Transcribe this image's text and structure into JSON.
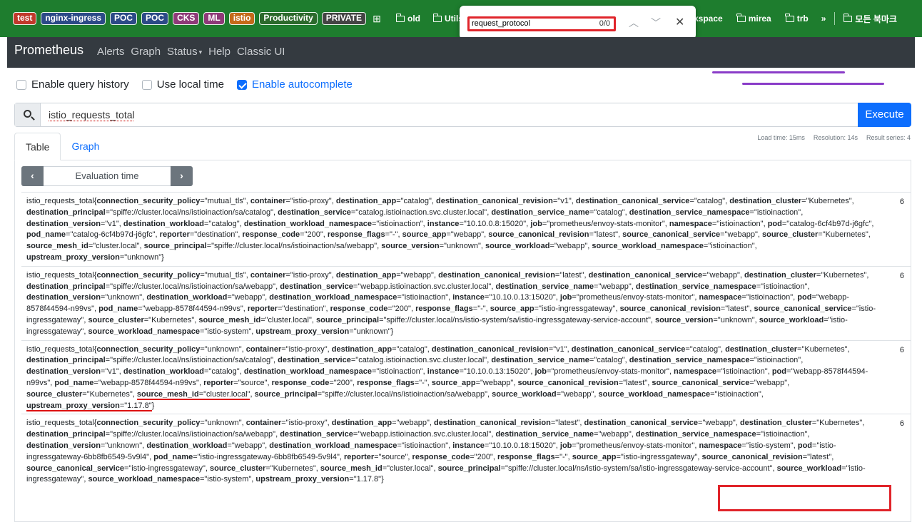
{
  "bookmarks": {
    "tags": [
      {
        "label": "test",
        "color": "red"
      },
      {
        "label": "nginx-ingress",
        "color": "blue"
      },
      {
        "label": "POC",
        "color": "blue"
      },
      {
        "label": "POC",
        "color": "blue"
      },
      {
        "label": "CKS",
        "color": "pink"
      },
      {
        "label": "ML",
        "color": "pink"
      },
      {
        "label": "istio",
        "color": "orange"
      },
      {
        "label": "Productivity",
        "color": "green"
      },
      {
        "label": "PRIVATE",
        "color": "dark"
      }
    ],
    "folders_left": [
      "old",
      "Utils"
    ],
    "folders_right": [
      "kspace",
      "mirea",
      "trb"
    ],
    "overflow": "»",
    "all_bookmarks": "모든 북마크"
  },
  "find": {
    "query": "request_protocol",
    "count": "0/0"
  },
  "nav": {
    "brand": "Prometheus",
    "items": [
      "Alerts",
      "Graph",
      "Status",
      "Help",
      "Classic UI"
    ]
  },
  "options": {
    "query_history": "Enable query history",
    "local_time": "Use local time",
    "autocomplete": "Enable autocomplete"
  },
  "query": {
    "expression": "istio_requests_total",
    "execute": "Execute"
  },
  "stats": {
    "load_time": "Load time: 15ms",
    "resolution": "Resolution: 14s",
    "result_series": "Result series: 4"
  },
  "tabs": {
    "table": "Table",
    "graph": "Graph"
  },
  "eval": {
    "label": "Evaluation time",
    "prev": "‹",
    "next": "›"
  },
  "results": [
    {
      "metric": "istio_requests_total",
      "value": "6",
      "labels": [
        [
          "connection_security_policy",
          "mutual_tls"
        ],
        [
          "container",
          "istio-proxy"
        ],
        [
          "destination_app",
          "catalog"
        ],
        [
          "destination_canonical_revision",
          "v1"
        ],
        [
          "destination_canonical_service",
          "catalog"
        ],
        [
          "destination_cluster",
          "Kubernetes"
        ],
        [
          "destination_principal",
          "spiffe://cluster.local/ns/istioinaction/sa/catalog"
        ],
        [
          "destination_service",
          "catalog.istioinaction.svc.cluster.local"
        ],
        [
          "destination_service_name",
          "catalog"
        ],
        [
          "destination_service_namespace",
          "istioinaction"
        ],
        [
          "destination_version",
          "v1"
        ],
        [
          "destination_workload",
          "catalog"
        ],
        [
          "destination_workload_namespace",
          "istioinaction"
        ],
        [
          "instance",
          "10.10.0.8:15020"
        ],
        [
          "job",
          "prometheus/envoy-stats-monitor"
        ],
        [
          "namespace",
          "istioinaction"
        ],
        [
          "pod",
          "catalog-6cf4b97d-j6gfc"
        ],
        [
          "pod_name",
          "catalog-6cf4b97d-j6gfc"
        ],
        [
          "reporter",
          "destination"
        ],
        [
          "response_code",
          "200"
        ],
        [
          "response_flags",
          "-"
        ],
        [
          "source_app",
          "webapp"
        ],
        [
          "source_canonical_revision",
          "latest"
        ],
        [
          "source_canonical_service",
          "webapp"
        ],
        [
          "source_cluster",
          "Kubernetes"
        ],
        [
          "source_mesh_id",
          "cluster.local"
        ],
        [
          "source_principal",
          "spiffe://cluster.local/ns/istioinaction/sa/webapp"
        ],
        [
          "source_version",
          "unknown"
        ],
        [
          "source_workload",
          "webapp"
        ],
        [
          "source_workload_namespace",
          "istioinaction"
        ],
        [
          "upstream_proxy_version",
          "unknown"
        ]
      ]
    },
    {
      "metric": "istio_requests_total",
      "value": "6",
      "labels": [
        [
          "connection_security_policy",
          "mutual_tls"
        ],
        [
          "container",
          "istio-proxy"
        ],
        [
          "destination_app",
          "webapp"
        ],
        [
          "destination_canonical_revision",
          "latest"
        ],
        [
          "destination_canonical_service",
          "webapp"
        ],
        [
          "destination_cluster",
          "Kubernetes"
        ],
        [
          "destination_principal",
          "spiffe://cluster.local/ns/istioinaction/sa/webapp"
        ],
        [
          "destination_service",
          "webapp.istioinaction.svc.cluster.local"
        ],
        [
          "destination_service_name",
          "webapp"
        ],
        [
          "destination_service_namespace",
          "istioinaction"
        ],
        [
          "destination_version",
          "unknown"
        ],
        [
          "destination_workload",
          "webapp"
        ],
        [
          "destination_workload_namespace",
          "istioinaction"
        ],
        [
          "instance",
          "10.10.0.13:15020"
        ],
        [
          "job",
          "prometheus/envoy-stats-monitor"
        ],
        [
          "namespace",
          "istioinaction"
        ],
        [
          "pod",
          "webapp-8578f44594-n99vs"
        ],
        [
          "pod_name",
          "webapp-8578f44594-n99vs"
        ],
        [
          "reporter",
          "destination"
        ],
        [
          "response_code",
          "200"
        ],
        [
          "response_flags",
          "-"
        ],
        [
          "source_app",
          "istio-ingressgateway"
        ],
        [
          "source_canonical_revision",
          "latest"
        ],
        [
          "source_canonical_service",
          "istio-ingressgateway"
        ],
        [
          "source_cluster",
          "Kubernetes"
        ],
        [
          "source_mesh_id",
          "cluster.local"
        ],
        [
          "source_principal",
          "spiffe://cluster.local/ns/istio-system/sa/istio-ingressgateway-service-account"
        ],
        [
          "source_version",
          "unknown"
        ],
        [
          "source_workload",
          "istio-ingressgateway"
        ],
        [
          "source_workload_namespace",
          "istio-system"
        ],
        [
          "upstream_proxy_version",
          "unknown"
        ]
      ]
    },
    {
      "metric": "istio_requests_total",
      "value": "6",
      "labels": [
        [
          "connection_security_policy",
          "unknown"
        ],
        [
          "container",
          "istio-proxy"
        ],
        [
          "destination_app",
          "catalog"
        ],
        [
          "destination_canonical_revision",
          "v1"
        ],
        [
          "destination_canonical_service",
          "catalog"
        ],
        [
          "destination_cluster",
          "Kubernetes"
        ],
        [
          "destination_principal",
          "spiffe://cluster.local/ns/istioinaction/sa/catalog"
        ],
        [
          "destination_service",
          "catalog.istioinaction.svc.cluster.local"
        ],
        [
          "destination_service_name",
          "catalog"
        ],
        [
          "destination_service_namespace",
          "istioinaction"
        ],
        [
          "destination_version",
          "v1"
        ],
        [
          "destination_workload",
          "catalog"
        ],
        [
          "destination_workload_namespace",
          "istioinaction"
        ],
        [
          "instance",
          "10.10.0.13:15020"
        ],
        [
          "job",
          "prometheus/envoy-stats-monitor"
        ],
        [
          "namespace",
          "istioinaction"
        ],
        [
          "pod",
          "webapp-8578f44594-n99vs"
        ],
        [
          "pod_name",
          "webapp-8578f44594-n99vs"
        ],
        [
          "reporter",
          "source"
        ],
        [
          "response_code",
          "200"
        ],
        [
          "response_flags",
          "-"
        ],
        [
          "source_app",
          "webapp"
        ],
        [
          "source_canonical_revision",
          "latest"
        ],
        [
          "source_canonical_service",
          "webapp"
        ],
        [
          "source_cluster",
          "Kubernetes"
        ],
        [
          "source_mesh_id",
          "cluster.local"
        ],
        [
          "source_principal",
          "spiffe://cluster.local/ns/istioinaction/sa/webapp"
        ],
        [
          "source_workload",
          "webapp"
        ],
        [
          "source_workload_namespace",
          "istioinaction"
        ],
        [
          "upstream_proxy_version",
          "1.17.8"
        ]
      ]
    },
    {
      "metric": "istio_requests_total",
      "value": "6",
      "labels": [
        [
          "connection_security_policy",
          "unknown"
        ],
        [
          "container",
          "istio-proxy"
        ],
        [
          "destination_app",
          "webapp"
        ],
        [
          "destination_canonical_revision",
          "latest"
        ],
        [
          "destination_canonical_service",
          "webapp"
        ],
        [
          "destination_cluster",
          "Kubernetes"
        ],
        [
          "destination_principal",
          "spiffe://cluster.local/ns/istioinaction/sa/webapp"
        ],
        [
          "destination_service",
          "webapp.istioinaction.svc.cluster.local"
        ],
        [
          "destination_service_name",
          "webapp"
        ],
        [
          "destination_service_namespace",
          "istioinaction"
        ],
        [
          "destination_version",
          "unknown"
        ],
        [
          "destination_workload",
          "webapp"
        ],
        [
          "destination_workload_namespace",
          "istioinaction"
        ],
        [
          "instance",
          "10.10.0.18:15020"
        ],
        [
          "job",
          "prometheus/envoy-stats-monitor"
        ],
        [
          "namespace",
          "istio-system"
        ],
        [
          "pod",
          "istio-ingressgateway-6bb8fb6549-5v9l4"
        ],
        [
          "pod_name",
          "istio-ingressgateway-6bb8fb6549-5v9l4"
        ],
        [
          "reporter",
          "source"
        ],
        [
          "response_code",
          "200"
        ],
        [
          "response_flags",
          "-"
        ],
        [
          "source_app",
          "istio-ingressgateway"
        ],
        [
          "source_canonical_revision",
          "latest"
        ],
        [
          "source_canonical_service",
          "istio-ingressgateway"
        ],
        [
          "source_cluster",
          "Kubernetes"
        ],
        [
          "source_mesh_id",
          "cluster.local"
        ],
        [
          "source_principal",
          "spiffe://cluster.local/ns/istio-system/sa/istio-ingressgateway-service-account"
        ],
        [
          "source_workload",
          "istio-ingressgateway"
        ],
        [
          "source_workload_namespace",
          "istio-system"
        ],
        [
          "upstream_proxy_version",
          "1.17.8"
        ]
      ]
    }
  ]
}
